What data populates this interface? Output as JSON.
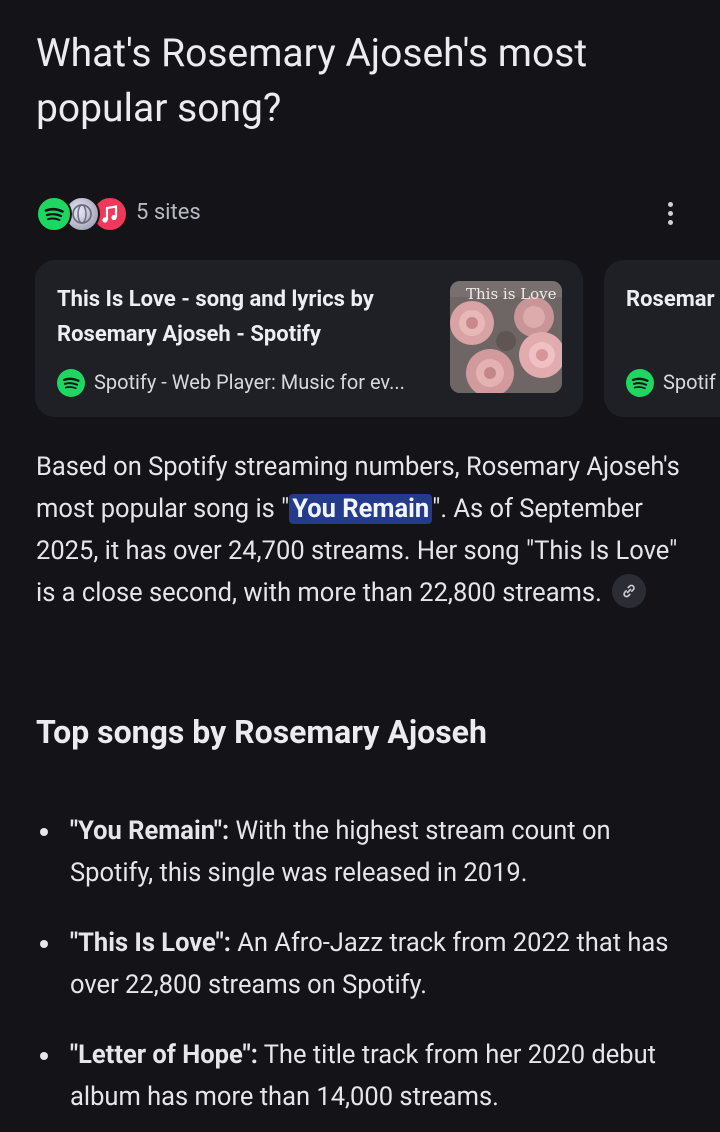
{
  "question": "What's Rosemary Ajoseh's most popular song?",
  "sources": {
    "count_label": "5 sites",
    "favicons": [
      "spotify-icon",
      "globe-icon",
      "apple-music-icon"
    ]
  },
  "cards": [
    {
      "title": "This Is Love - song and lyrics by Rosemary Ajoseh - Spotify",
      "source": "Spotify - Web Player: Music for ev...",
      "thumbnail_text": "This is Love"
    },
    {
      "title": "Rosemar",
      "source": "Spotif"
    }
  ],
  "answer": {
    "before": "Based on Spotify streaming numbers, Rosemary Ajoseh's most popular song is \"",
    "highlight": "You Remain",
    "after": "\". As of September 2025, it has over 24,700 streams. Her song \"This Is Love\" is a close second, with more than 22,800 streams."
  },
  "section_heading": "Top songs by Rosemary Ajoseh",
  "songs": [
    {
      "name": "\"You Remain\":",
      "desc": " With the highest stream count on Spotify, this single was released in 2019."
    },
    {
      "name": "\"This Is Love\":",
      "desc": " An Afro-Jazz track from 2022 that has over 22,800 streams on Spotify."
    },
    {
      "name": "\"Letter of Hope\":",
      "desc": " The title track from her 2020 debut album has more than 14,000 streams."
    }
  ],
  "colors": {
    "background": "#141418",
    "card": "#1f1f26",
    "highlight": "#243b8c",
    "spotify_green": "#1ed760"
  }
}
